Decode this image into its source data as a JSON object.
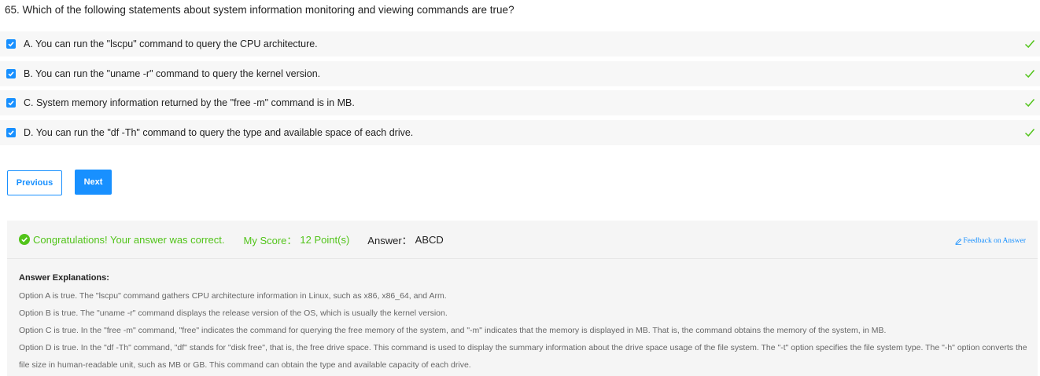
{
  "question": "65. Which of the following statements about system information monitoring and viewing commands are true?",
  "options": [
    {
      "label": "A. You can run the \"lscpu\" command to query the CPU architecture.",
      "checked": true,
      "correct": true
    },
    {
      "label": "B. You can run the \"uname -r\" command to query the kernel version.",
      "checked": true,
      "correct": true
    },
    {
      "label": "C. System memory information returned by the \"free -m\" command is in MB.",
      "checked": true,
      "correct": true
    },
    {
      "label": "D. You can run the \"df -Th\" command to query the type and available space of each drive.",
      "checked": true,
      "correct": true
    }
  ],
  "buttons": {
    "previous": "Previous",
    "next": "Next"
  },
  "result": {
    "congrats": "Congratulations! Your answer was correct.",
    "score_label": "My Score：",
    "score_value": "12 Point(s)",
    "answer_label": "Answer：",
    "answer_value": "ABCD",
    "feedback": "Feedback on Answer"
  },
  "explanation": {
    "title": "Answer Explanations:",
    "lines": [
      "Option A is true. The \"lscpu\" command gathers CPU architecture information in Linux, such as x86, x86_64, and Arm.",
      "Option B is true. The \"uname -r\" command displays the release version of the OS, which is usually the kernel version.",
      "Option C is true. In the \"free -m\" command, \"free\" indicates the command for querying the free memory of the system, and \"-m\" indicates that the memory is displayed in MB. That is, the command obtains the memory of the system, in MB.",
      "Option D is true. In the \"df -Th\" command, \"df\" stands for \"disk free\", that is, the free drive space. This command is used to display the summary information about the drive space usage of the file system. The \"-t\" option specifies the file system type. The \"-h\" option converts the file size in human-readable unit, such as MB or GB. This command can obtain the type and available capacity of each drive."
    ]
  },
  "colors": {
    "accent": "#1890ff",
    "success": "#52c41a"
  }
}
